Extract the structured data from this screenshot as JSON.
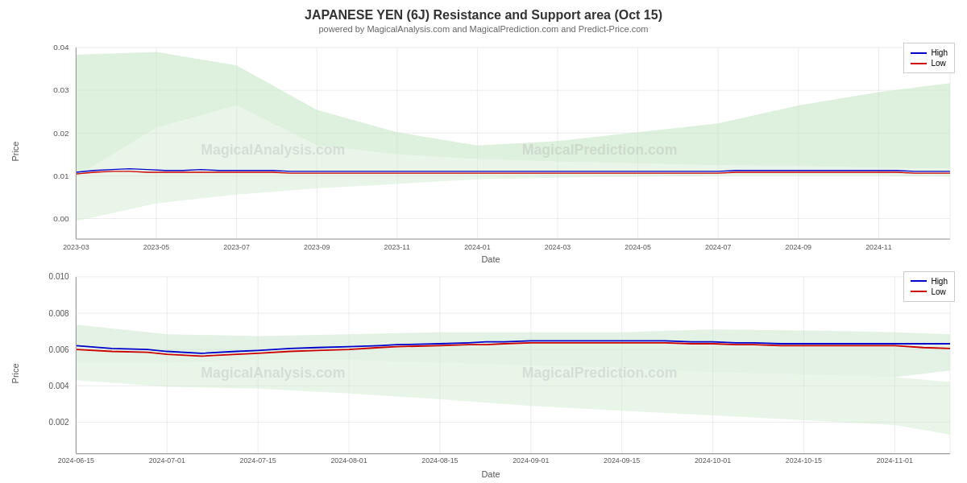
{
  "title": "JAPANESE YEN (6J) Resistance and Support area (Oct 15)",
  "subtitle": "powered by MagicalAnalysis.com and MagicalPrediction.com and Predict-Price.com",
  "chart_top": {
    "y_label": "Price",
    "x_label": "Date",
    "y_ticks": [
      "0.04",
      "0.03",
      "0.02",
      "0.01",
      "0.00"
    ],
    "x_ticks": [
      "2023-03",
      "2023-05",
      "2023-07",
      "2023-09",
      "2023-11",
      "2024-01",
      "2024-03",
      "2024-05",
      "2024-07",
      "2024-09",
      "2024-11"
    ],
    "legend": {
      "high_label": "High",
      "low_label": "Low",
      "high_color": "#0000cc",
      "low_color": "#cc0000"
    }
  },
  "chart_bottom": {
    "y_label": "Price",
    "x_label": "Date",
    "y_ticks": [
      "0.010",
      "0.008",
      "0.006",
      "0.004",
      "0.002"
    ],
    "x_ticks": [
      "2024-06-15",
      "2024-07-01",
      "2024-07-15",
      "2024-08-01",
      "2024-08-15",
      "2024-09-01",
      "2024-09-15",
      "2024-10-01",
      "2024-10-15",
      "2024-11-01"
    ],
    "legend": {
      "high_label": "High",
      "low_label": "Low",
      "high_color": "#0000cc",
      "low_color": "#cc0000"
    }
  },
  "watermarks": [
    "MagicalAnalysis.com",
    "MagicalPrediction.com"
  ]
}
